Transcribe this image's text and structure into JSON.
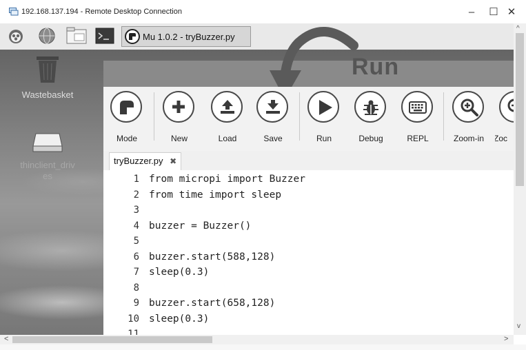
{
  "window": {
    "title": "192.168.137.194 - Remote Desktop Connection",
    "minimize_glyph": "–",
    "maximize_glyph": "☐",
    "close_glyph": "✕"
  },
  "taskbar": {
    "icons": [
      "raspberry-menu-icon",
      "web-browser-icon",
      "file-manager-icon",
      "terminal-icon"
    ],
    "active_window": "Mu 1.0.2 - tryBuzzer.py"
  },
  "desktop_icons": [
    {
      "icon": "wastebasket-icon",
      "label": "Wastebasket"
    },
    {
      "icon": "drive-icon",
      "label": "thinclient_driv\nes"
    }
  ],
  "annotation": {
    "text": "Run"
  },
  "toolbar": [
    {
      "label": "Mode",
      "icon": "mode-icon"
    },
    {
      "label": "New",
      "icon": "plus-icon"
    },
    {
      "label": "Load",
      "icon": "load-icon"
    },
    {
      "label": "Save",
      "icon": "save-icon"
    },
    {
      "label": "Run",
      "icon": "play-icon"
    },
    {
      "label": "Debug",
      "icon": "bug-icon"
    },
    {
      "label": "REPL",
      "icon": "keyboard-icon"
    },
    {
      "label": "Zoom-in",
      "icon": "zoom-in-icon"
    },
    {
      "label": "Zoc",
      "icon": "zoom-out-icon"
    }
  ],
  "tab": {
    "label": "tryBuzzer.py",
    "close_glyph": "✖"
  },
  "editor": {
    "lines": [
      {
        "n": "1",
        "code": "from micropi import Buzzer"
      },
      {
        "n": "2",
        "code": "from time import sleep"
      },
      {
        "n": "3",
        "code": ""
      },
      {
        "n": "4",
        "code": "buzzer = Buzzer()"
      },
      {
        "n": "5",
        "code": ""
      },
      {
        "n": "6",
        "code": "buzzer.start(588,128)"
      },
      {
        "n": "7",
        "code": "sleep(0.3)"
      },
      {
        "n": "8",
        "code": ""
      },
      {
        "n": "9",
        "code": "buzzer.start(658,128)"
      },
      {
        "n": "10",
        "code": "sleep(0.3)"
      },
      {
        "n": "11",
        "code": ""
      }
    ]
  },
  "scroll": {
    "left_glyph": "<",
    "right_glyph": ">",
    "up_glyph": "^",
    "down_glyph": "v"
  }
}
